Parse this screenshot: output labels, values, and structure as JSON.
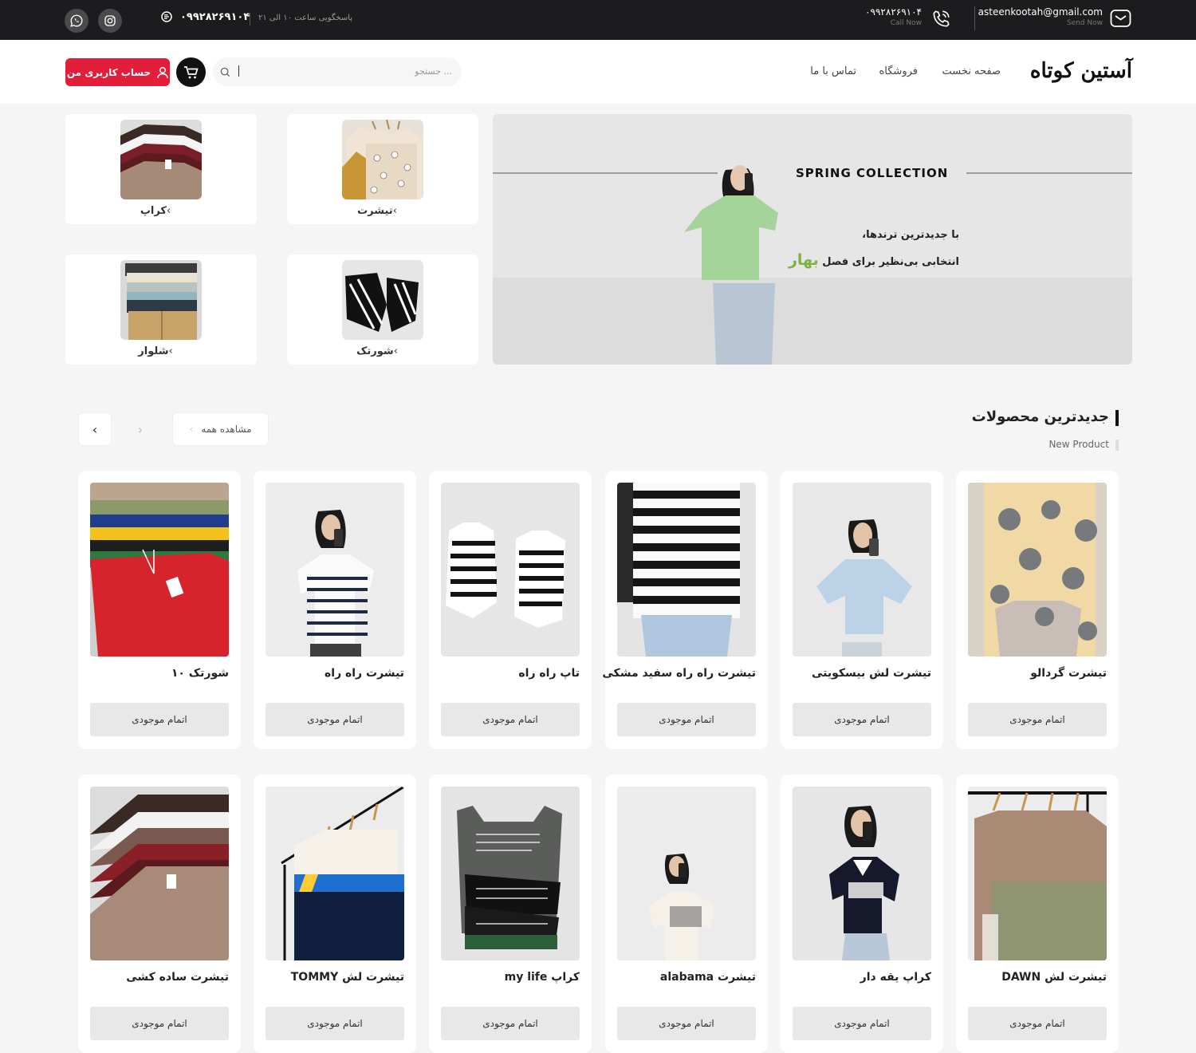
{
  "topbar": {
    "email": "asteenkootah@gmail.com",
    "email_sub": "Send Now",
    "phone": "۰۹۹۲۸۲۶۹۱۰۴",
    "phone_sub": "Call Now",
    "phone_left": "۰۹۹۲۸۲۶۹۱۰۴",
    "hours": "پاسخگویی ساعت ۱۰ الی ۲۱",
    "social": [
      {
        "icon": "whatsapp-icon"
      },
      {
        "icon": "instagram-icon"
      }
    ]
  },
  "header": {
    "logo": "آستین کوتاه",
    "nav": [
      "صفحه نخست",
      "فروشگاه",
      "تماس با ما"
    ],
    "search_placeholder": "جستجو ...",
    "account_label": "حساب کاربری من",
    "accent": "#e31e3a"
  },
  "categories": [
    {
      "label": "تیشرت"
    },
    {
      "label": "کراپ"
    },
    {
      "label": "شورتک"
    },
    {
      "label": "شلوار"
    }
  ],
  "banner": {
    "title": "SPRING COLLECTION",
    "line1": "با جدیدترین ترندها،",
    "line2": "انتخابی بی‌نظیر برای فصل",
    "highlight": "بهار",
    "highlight_color": "#7cb342"
  },
  "section": {
    "title": "جدیدترین محصولات",
    "subtitle": "New Product",
    "view_all": "مشاهده همه"
  },
  "products": [
    {
      "name": "تیشرت گردالو",
      "button": "اتمام موجودی"
    },
    {
      "name": "تیشرت لش بیسکویتی",
      "button": "اتمام موجودی"
    },
    {
      "name": "تیشرت راه راه سفید مشکی",
      "button": "اتمام موجودی"
    },
    {
      "name": "تاپ راه راه",
      "button": "اتمام موجودی"
    },
    {
      "name": "تیشرت راه راه",
      "button": "اتمام موجودی"
    },
    {
      "name": "شورتک ۱۰",
      "button": "اتمام موجودی"
    },
    {
      "name": "تیشرت لش DAWN",
      "button": "اتمام موجودی"
    },
    {
      "name": "کراپ یقه دار",
      "button": "اتمام موجودی"
    },
    {
      "name": "تیشرت alabama",
      "button": "اتمام موجودی"
    },
    {
      "name": "کراپ my life",
      "button": "اتمام موجودی"
    },
    {
      "name": "تیشرت لش TOMMY",
      "button": "اتمام موجودی"
    },
    {
      "name": "تیشرت ساده کشی",
      "button": "اتمام موجودی"
    }
  ]
}
